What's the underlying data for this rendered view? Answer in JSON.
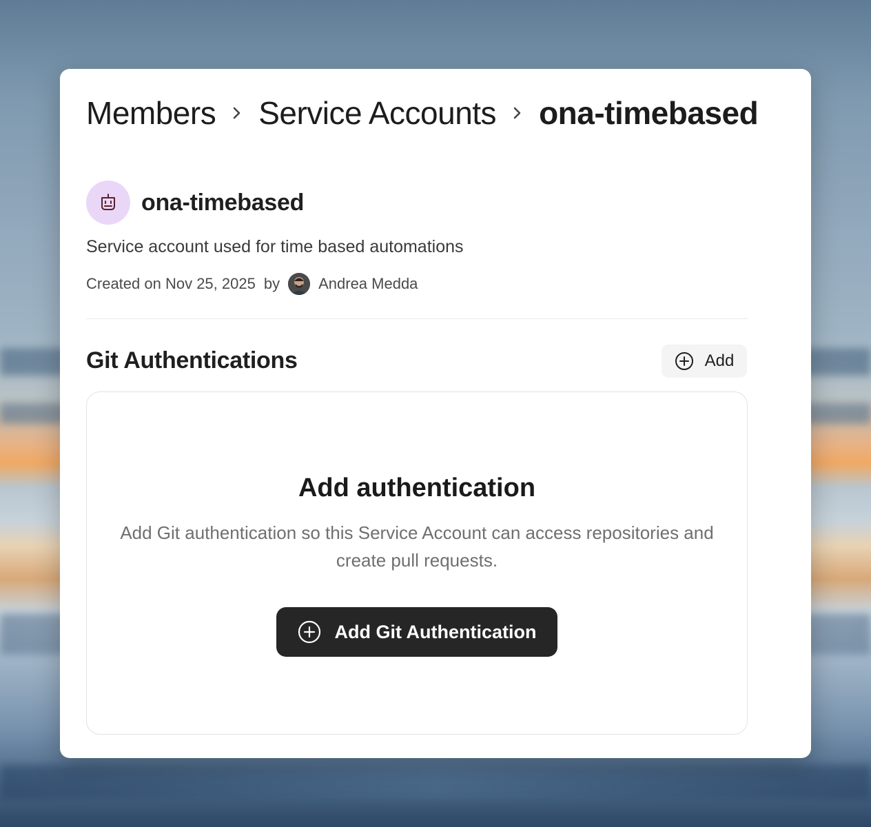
{
  "breadcrumb": {
    "items": [
      "Members",
      "Service Accounts",
      "ona-timebased"
    ]
  },
  "account": {
    "name": "ona-timebased",
    "description": "Service account used for time based automations",
    "created_prefix": "Created on Nov 25, 2025",
    "by_label": "by",
    "creator_name": "Andrea Medda",
    "icon": "robot-icon"
  },
  "git_auth": {
    "title": "Git Authentications",
    "add_label": "Add",
    "empty_title": "Add authentication",
    "empty_text": "Add Git authentication so this Service Account can access repositories and create pull requests.",
    "primary_label": "Add Git Authentication"
  },
  "colors": {
    "bot_avatar_bg": "#ead7f7",
    "primary_button_bg": "#262626",
    "card_bg": "#ffffff"
  }
}
